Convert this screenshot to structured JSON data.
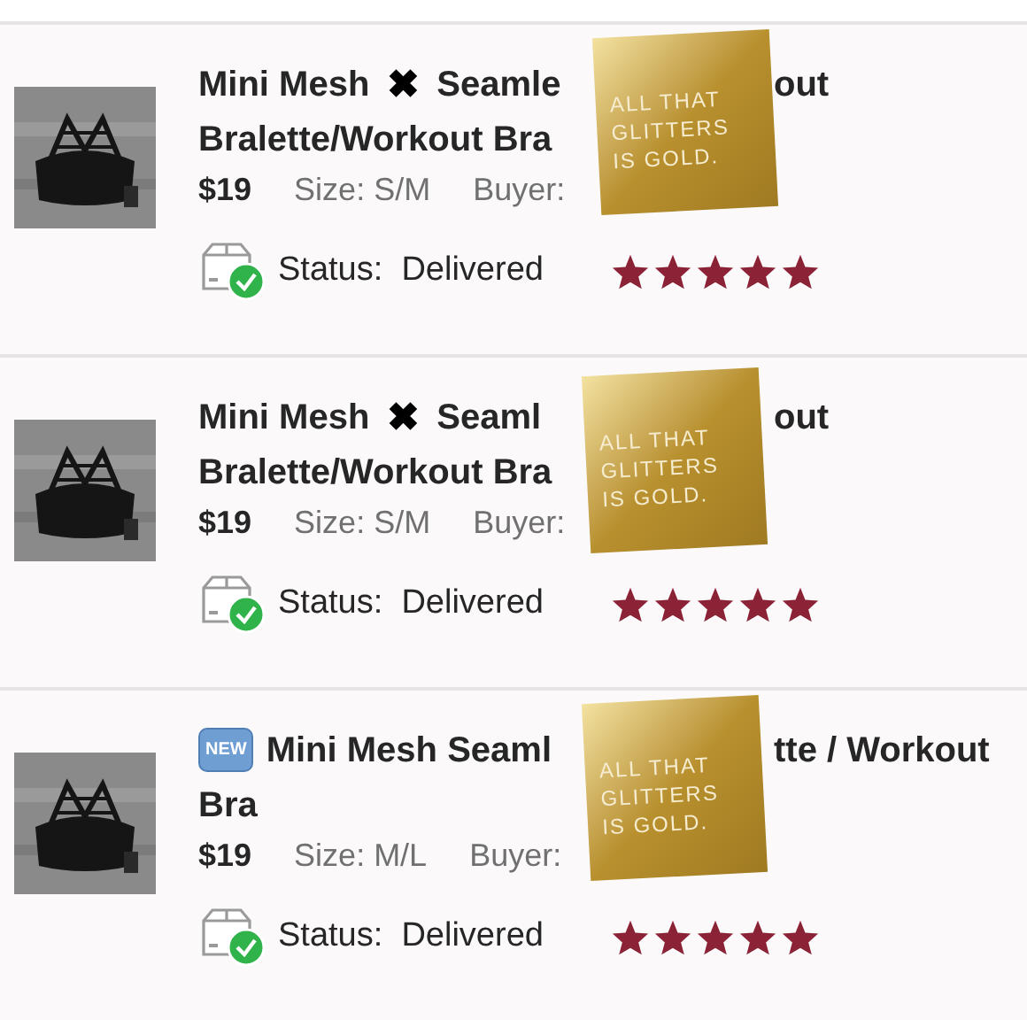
{
  "listings": [
    {
      "thumbnail": {
        "kind": "picture"
      },
      "title_lines": [
        [
          {
            "kind": "text",
            "text": "Mini Mesh"
          },
          {
            "kind": "symbol",
            "text": "✖"
          },
          {
            "kind": "text",
            "text": "Seamle"
          },
          {
            "kind": "gap"
          },
          {
            "kind": "text",
            "text": "out"
          }
        ],
        [
          {
            "kind": "text",
            "text": "Bralette/Workout Bra"
          }
        ]
      ],
      "price": "$19",
      "size": "Size: S/M",
      "buyer": "Buyer:",
      "status": "Status:  Delivered",
      "stars": 5,
      "sticker": "ALL THAT\nGLITTERS\nIS GOLD."
    },
    {
      "thumbnail": {
        "kind": "picture"
      },
      "title_lines": [
        [
          {
            "kind": "text",
            "text": "Mini Mesh"
          },
          {
            "kind": "symbol",
            "text": "✖"
          },
          {
            "kind": "text",
            "text": "Seaml"
          },
          {
            "kind": "gap"
          },
          {
            "kind": "text",
            "text": "out"
          }
        ],
        [
          {
            "kind": "text",
            "text": "Bralette/Workout Bra"
          }
        ]
      ],
      "price": "$19",
      "size": "Size: S/M",
      "buyer": "Buyer:",
      "status": "Status:  Delivered",
      "stars": 5,
      "sticker": "ALL THAT\nGLITTERS\nIS GOLD."
    },
    {
      "thumbnail": {
        "kind": "picture"
      },
      "title_lines": [
        [
          {
            "kind": "badge",
            "text": "NEW"
          },
          {
            "kind": "text",
            "text": "Mini Mesh Seaml"
          },
          {
            "kind": "gap"
          },
          {
            "kind": "text",
            "text": "tte / Workout"
          }
        ],
        [
          {
            "kind": "text",
            "text": "Bra"
          }
        ]
      ],
      "price": "$19",
      "size": "Size: M/L",
      "buyer": "Buyer:",
      "status": "Status:  Delivered",
      "stars": 5,
      "sticker": "ALL THAT\nGLITTERS\nIS GOLD."
    }
  ]
}
